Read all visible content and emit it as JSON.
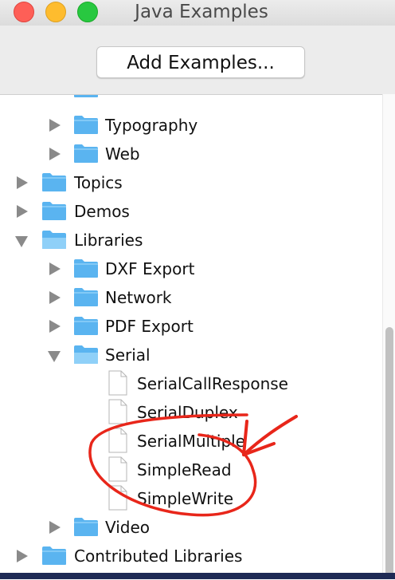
{
  "window": {
    "title": "Java Examples",
    "add_button_label": "Add Examples..."
  },
  "tree": {
    "rows": [
      {
        "label": "Typography",
        "kind": "folder",
        "state": "collapsed",
        "level": 1
      },
      {
        "label": "Web",
        "kind": "folder",
        "state": "collapsed",
        "level": 1
      },
      {
        "label": "Topics",
        "kind": "folder",
        "state": "collapsed",
        "level": 0
      },
      {
        "label": "Demos",
        "kind": "folder",
        "state": "collapsed",
        "level": 0
      },
      {
        "label": "Libraries",
        "kind": "folder",
        "state": "expanded",
        "level": 0
      },
      {
        "label": "DXF Export",
        "kind": "folder",
        "state": "collapsed",
        "level": 1
      },
      {
        "label": "Network",
        "kind": "folder",
        "state": "collapsed",
        "level": 1
      },
      {
        "label": "PDF Export",
        "kind": "folder",
        "state": "collapsed",
        "level": 1
      },
      {
        "label": "Serial",
        "kind": "folder",
        "state": "expanded",
        "level": 1
      },
      {
        "label": "SerialCallResponse",
        "kind": "file",
        "level": 2
      },
      {
        "label": "SerialDuplex",
        "kind": "file",
        "level": 2
      },
      {
        "label": "SerialMultiple",
        "kind": "file",
        "level": 2
      },
      {
        "label": "SimpleRead",
        "kind": "file",
        "level": 2
      },
      {
        "label": "SimpleWrite",
        "kind": "file",
        "level": 2
      },
      {
        "label": "Video",
        "kind": "folder",
        "state": "collapsed",
        "level": 1
      },
      {
        "label": "Contributed Libraries",
        "kind": "folder",
        "state": "collapsed",
        "level": 0
      }
    ]
  },
  "colors": {
    "folder_blue": "#5ab4f0",
    "annotation_red": "#e8261a",
    "traffic_red": "#fe5f57",
    "traffic_yellow": "#febc2e",
    "traffic_green": "#28c840"
  },
  "icons": {
    "folder": "folder-icon",
    "file": "document-icon",
    "expand": "disclosure-triangle-icon"
  }
}
